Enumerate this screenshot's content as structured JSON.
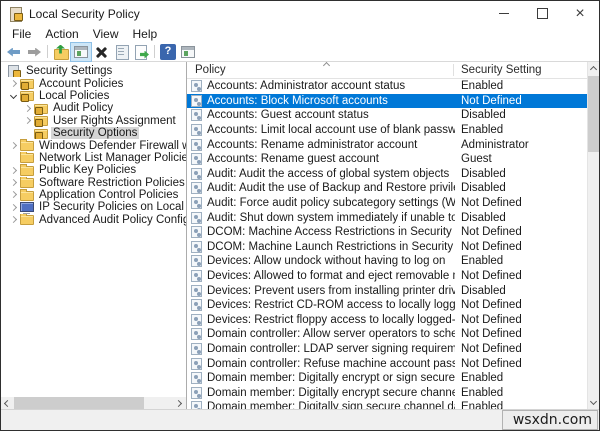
{
  "window": {
    "title": "Local Security Policy"
  },
  "menu": {
    "items": [
      "File",
      "Action",
      "View",
      "Help"
    ]
  },
  "toolbar": {
    "buttons": [
      {
        "name": "back-button",
        "icon": "arrow-left-icon"
      },
      {
        "name": "forward-button",
        "icon": "arrow-right-icon"
      },
      {
        "type": "separator"
      },
      {
        "name": "up-one-level-button",
        "icon": "folder-up-icon"
      },
      {
        "name": "show-console-tree-button",
        "icon": "console-window-icon",
        "active": true
      },
      {
        "name": "delete-button",
        "icon": "delete-x-icon"
      },
      {
        "name": "properties-button",
        "icon": "properties-icon"
      },
      {
        "name": "export-list-button",
        "icon": "export-list-icon"
      },
      {
        "type": "separator"
      },
      {
        "name": "help-button",
        "icon": "help-icon"
      },
      {
        "name": "new-window-button",
        "icon": "window-icon"
      }
    ]
  },
  "tree": {
    "items": [
      {
        "label": "Security Settings",
        "level": 0,
        "icon": "root",
        "expander": null,
        "selected": false
      },
      {
        "label": "Account Policies",
        "level": 1,
        "icon": "folder-lock",
        "expander": "right",
        "selected": false
      },
      {
        "label": "Local Policies",
        "level": 1,
        "icon": "folder-lock",
        "expander": "down",
        "selected": false
      },
      {
        "label": "Audit Policy",
        "level": 2,
        "icon": "folder-lock",
        "expander": "right",
        "selected": false
      },
      {
        "label": "User Rights Assignment",
        "level": 2,
        "icon": "folder-lock",
        "expander": "right",
        "selected": false
      },
      {
        "label": "Security Options",
        "level": 2,
        "icon": "folder-lock",
        "expander": "none",
        "selected": true
      },
      {
        "label": "Windows Defender Firewall with Adva",
        "level": 1,
        "icon": "folder",
        "expander": "right",
        "selected": false
      },
      {
        "label": "Network List Manager Policies",
        "level": 1,
        "icon": "folder",
        "expander": "none",
        "selected": false
      },
      {
        "label": "Public Key Policies",
        "level": 1,
        "icon": "folder",
        "expander": "right",
        "selected": false
      },
      {
        "label": "Software Restriction Policies",
        "level": 1,
        "icon": "folder",
        "expander": "right",
        "selected": false
      },
      {
        "label": "Application Control Policies",
        "level": 1,
        "icon": "folder",
        "expander": "right",
        "selected": false
      },
      {
        "label": "IP Security Policies on Local Compute",
        "level": 1,
        "icon": "computer",
        "expander": "right",
        "selected": false
      },
      {
        "label": "Advanced Audit Policy Configuration",
        "level": 1,
        "icon": "folder",
        "expander": "right",
        "selected": false
      }
    ]
  },
  "list": {
    "columns": [
      "Policy",
      "Security Setting"
    ],
    "rows": [
      {
        "policy": "Accounts: Administrator account status",
        "setting": "Enabled",
        "selected": false
      },
      {
        "policy": "Accounts: Block Microsoft accounts",
        "setting": "Not Defined",
        "selected": true
      },
      {
        "policy": "Accounts: Guest account status",
        "setting": "Disabled",
        "selected": false
      },
      {
        "policy": "Accounts: Limit local account use of blank passwords to co...",
        "setting": "Enabled",
        "selected": false
      },
      {
        "policy": "Accounts: Rename administrator account",
        "setting": "Administrator",
        "selected": false
      },
      {
        "policy": "Accounts: Rename guest account",
        "setting": "Guest",
        "selected": false
      },
      {
        "policy": "Audit: Audit the access of global system objects",
        "setting": "Disabled",
        "selected": false
      },
      {
        "policy": "Audit: Audit the use of Backup and Restore privilege",
        "setting": "Disabled",
        "selected": false
      },
      {
        "policy": "Audit: Force audit policy subcategory settings (Windows Vis...",
        "setting": "Not Defined",
        "selected": false
      },
      {
        "policy": "Audit: Shut down system immediately if unable to log secur...",
        "setting": "Disabled",
        "selected": false
      },
      {
        "policy": "DCOM: Machine Access Restrictions in Security Descriptor D...",
        "setting": "Not Defined",
        "selected": false
      },
      {
        "policy": "DCOM: Machine Launch Restrictions in Security Descriptor ...",
        "setting": "Not Defined",
        "selected": false
      },
      {
        "policy": "Devices: Allow undock without having to log on",
        "setting": "Enabled",
        "selected": false
      },
      {
        "policy": "Devices: Allowed to format and eject removable media",
        "setting": "Not Defined",
        "selected": false
      },
      {
        "policy": "Devices: Prevent users from installing printer drivers",
        "setting": "Disabled",
        "selected": false
      },
      {
        "policy": "Devices: Restrict CD-ROM access to locally logged-on user ...",
        "setting": "Not Defined",
        "selected": false
      },
      {
        "policy": "Devices: Restrict floppy access to locally logged-on user only",
        "setting": "Not Defined",
        "selected": false
      },
      {
        "policy": "Domain controller: Allow server operators to schedule tasks",
        "setting": "Not Defined",
        "selected": false
      },
      {
        "policy": "Domain controller: LDAP server signing requirements",
        "setting": "Not Defined",
        "selected": false
      },
      {
        "policy": "Domain controller: Refuse machine account password chan...",
        "setting": "Not Defined",
        "selected": false
      },
      {
        "policy": "Domain member: Digitally encrypt or sign secure channel d...",
        "setting": "Enabled",
        "selected": false
      },
      {
        "policy": "Domain member: Digitally encrypt secure channel data (wh...",
        "setting": "Enabled",
        "selected": false
      },
      {
        "policy": "Domain member: Digitally sign secure channel data (when ...",
        "setting": "Enabled",
        "selected": false
      }
    ]
  },
  "statusbar": {
    "watermark": "wsxdn.com"
  },
  "colors": {
    "selection_blue": "#0078d7",
    "tree_selection_gray": "#d5d5d5",
    "toolbar_active_bg": "#cde6f7",
    "folder_yellow": "#f6cd62",
    "statusbar_gray": "#f0f0f0"
  }
}
